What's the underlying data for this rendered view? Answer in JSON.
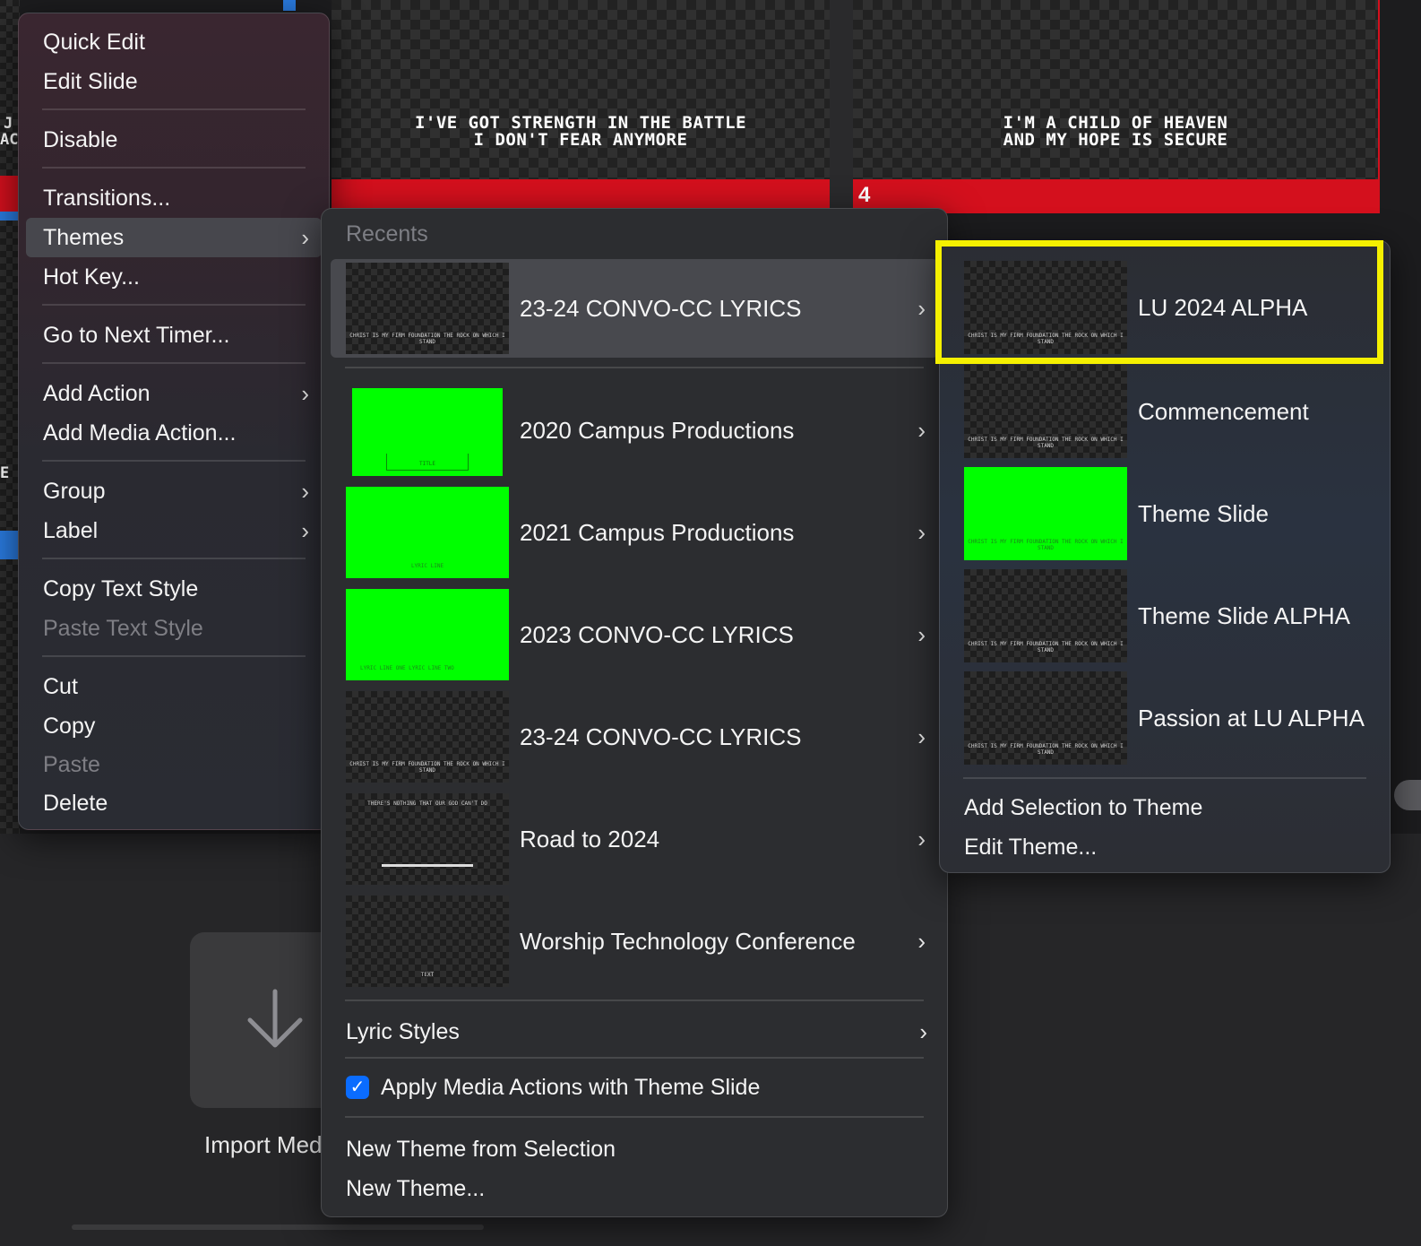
{
  "background": {
    "slides": [
      {
        "lyrics": "I'VE GOT STRENGTH IN THE BATTLE\nI DON'T FEAR ANYMORE",
        "number": ""
      },
      {
        "lyrics": "I'M A CHILD OF HEAVEN\nAND MY HOPE IS SECURE",
        "number": "4"
      }
    ],
    "left_fragments": [
      "J",
      "AC",
      "E"
    ],
    "import_label": "Import Med"
  },
  "context_menu": {
    "items": [
      {
        "label": "Quick Edit"
      },
      {
        "label": "Edit Slide"
      },
      {
        "label": "Disable"
      },
      {
        "label": "Transitions..."
      },
      {
        "label": "Themes"
      },
      {
        "label": "Hot Key..."
      },
      {
        "label": "Go to Next Timer..."
      },
      {
        "label": "Add Action"
      },
      {
        "label": "Add Media Action..."
      },
      {
        "label": "Group"
      },
      {
        "label": "Label"
      },
      {
        "label": "Copy Text Style"
      },
      {
        "label": "Paste Text Style"
      },
      {
        "label": "Cut"
      },
      {
        "label": "Copy"
      },
      {
        "label": "Paste"
      },
      {
        "label": "Delete"
      }
    ]
  },
  "themes_menu": {
    "recents_label": "Recents",
    "recent": {
      "label": "23-24 CONVO-CC LYRICS",
      "thumb_text": "CHRIST IS MY FIRM FOUNDATION THE ROCK ON WHICH I STAND"
    },
    "themes": [
      {
        "label": "2020 Campus Productions",
        "thumb_text": "TITLE"
      },
      {
        "label": "2021 Campus Productions",
        "thumb_text": "LYRIC LINE"
      },
      {
        "label": "2023 CONVO-CC LYRICS",
        "thumb_text": "LYRIC LINE ONE LYRIC LINE TWO"
      },
      {
        "label": "23-24 CONVO-CC LYRICS",
        "thumb_text": "CHRIST IS MY FIRM FOUNDATION THE ROCK ON WHICH I STAND"
      },
      {
        "label": "Road to 2024",
        "thumb_text": "THERE'S NOTHING THAT OUR GOD CAN'T DO"
      },
      {
        "label": "Worship Technology Conference",
        "thumb_text": "TEXT"
      }
    ],
    "lyric_styles": "Lyric Styles",
    "apply_media": "Apply Media Actions with Theme Slide",
    "apply_media_checked": true,
    "new_from_selection": "New Theme from Selection",
    "new_theme": "New Theme..."
  },
  "theme_submenu": {
    "slides": [
      {
        "label": "LU 2024 ALPHA",
        "thumb_text": "CHRIST IS MY FIRM FOUNDATION THE ROCK ON WHICH I STAND"
      },
      {
        "label": "Commencement",
        "thumb_text": "CHRIST IS MY FIRM FOUNDATION THE ROCK ON WHICH I STAND"
      },
      {
        "label": "Theme Slide",
        "thumb_text": "CHRIST IS MY FIRM FOUNDATION THE ROCK ON WHICH I STAND"
      },
      {
        "label": "Theme Slide ALPHA",
        "thumb_text": "CHRIST IS MY FIRM FOUNDATION THE ROCK ON WHICH I STAND"
      },
      {
        "label": "Passion at LU ALPHA",
        "thumb_text": "CHRIST IS MY FIRM FOUNDATION THE ROCK ON WHICH I STAND"
      }
    ],
    "add_selection": "Add Selection to Theme",
    "edit_theme": "Edit Theme..."
  },
  "colors": {
    "accent_red": "#d4101d",
    "chroma_green": "#00ff00",
    "highlight_yellow": "#f5f000",
    "checkbox_blue": "#0a6cff"
  }
}
